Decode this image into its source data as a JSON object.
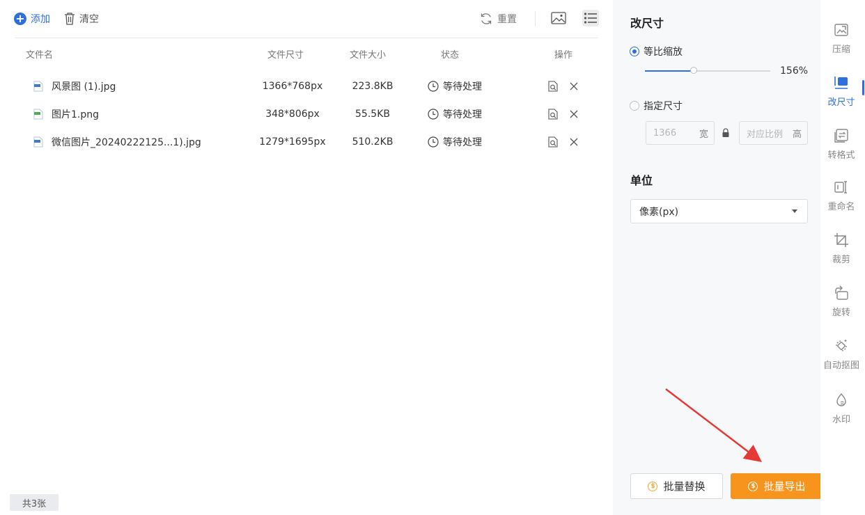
{
  "toolbar": {
    "add_label": "添加",
    "clear_label": "清空",
    "reset_label": "重置"
  },
  "table": {
    "headers": [
      "文件名",
      "文件尺寸",
      "文件大小",
      "状态",
      "操作"
    ],
    "rows": [
      {
        "name": "风景图 (1).jpg",
        "dimensions": "1366*768px",
        "size": "223.8KB",
        "status": "等待处理",
        "type": "jpg"
      },
      {
        "name": "图片1.png",
        "dimensions": "348*806px",
        "size": "55.5KB",
        "status": "等待处理",
        "type": "png"
      },
      {
        "name": "微信图片_20240222125...1).jpg",
        "dimensions": "1279*1695px",
        "size": "510.2KB",
        "status": "等待处理",
        "type": "jpg"
      }
    ]
  },
  "footer": {
    "count": "共3张"
  },
  "resize_panel": {
    "title": "改尺寸",
    "option_proportional": "等比缩放",
    "option_specify": "指定尺寸",
    "scale_percent": 156,
    "scale_text": "156%",
    "width_value": "1366",
    "width_unit": "宽",
    "height_placeholder": "对应比例",
    "height_unit": "高",
    "unit_title": "单位",
    "unit_selected": "像素(px)",
    "batch_replace": "批量替换",
    "batch_export": "批量导出"
  },
  "rail": {
    "items": [
      {
        "label": "压缩",
        "icon": "compress-icon"
      },
      {
        "label": "改尺寸",
        "icon": "resize-icon",
        "active": true
      },
      {
        "label": "转格式",
        "icon": "convert-format-icon"
      },
      {
        "label": "重命名",
        "icon": "rename-icon"
      },
      {
        "label": "裁剪",
        "icon": "crop-icon"
      },
      {
        "label": "旋转",
        "icon": "rotate-icon"
      },
      {
        "label": "自动抠图",
        "icon": "auto-cutout-icon"
      },
      {
        "label": "水印",
        "icon": "watermark-icon"
      }
    ]
  },
  "colors": {
    "accent": "#2f6fdc",
    "export_button": "#f7941d",
    "annotation_arrow": "#e53935"
  }
}
